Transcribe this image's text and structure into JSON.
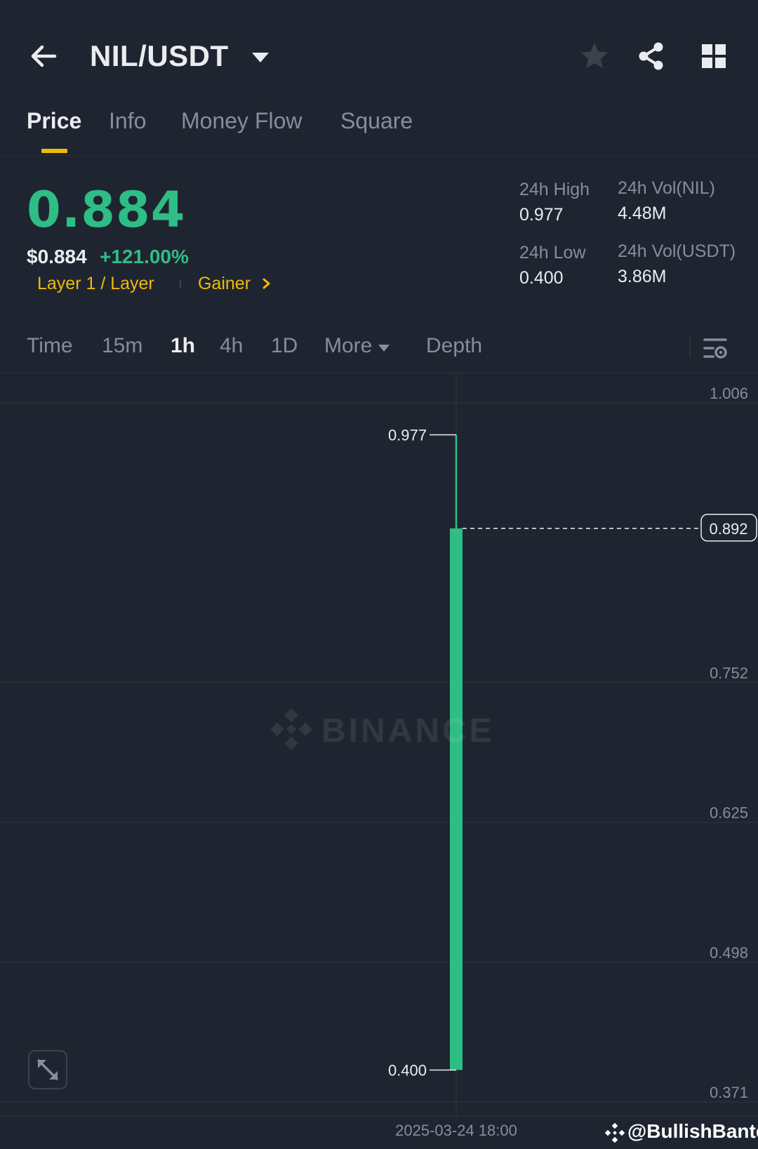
{
  "header": {
    "pair": "NIL/USDT",
    "icons": [
      "back-arrow-icon",
      "caret-down-icon",
      "star-icon",
      "share-icon",
      "grid-icon"
    ]
  },
  "tabs": [
    {
      "label": "Price",
      "active": true
    },
    {
      "label": "Info",
      "active": false
    },
    {
      "label": "Money Flow",
      "active": false
    },
    {
      "label": "Square",
      "active": false
    }
  ],
  "ticker": {
    "last_price": "0.884",
    "usd_price": "$0.884",
    "change_pct": "+121.00%",
    "tags": [
      "Layer 1 / Layer",
      "Gainer"
    ],
    "stats": {
      "high_label": "24h High",
      "high_value": "0.977",
      "low_label": "24h Low",
      "low_value": "0.400",
      "vol_base_label": "24h Vol(NIL)",
      "vol_base_value": "4.48M",
      "vol_quote_label": "24h Vol(USDT)",
      "vol_quote_value": "3.86M"
    }
  },
  "intervals": {
    "items": [
      "Time",
      "15m",
      "1h",
      "4h",
      "1D",
      "More",
      "Depth"
    ],
    "active": "1h"
  },
  "chart_data": {
    "type": "candlestick",
    "y_ticks": [
      "1.006",
      "0.752",
      "0.625",
      "0.498",
      "0.371"
    ],
    "ylim": [
      0.371,
      1.006
    ],
    "candles": [
      {
        "time": "2025-03-24 18:00",
        "open": 0.4,
        "high": 0.977,
        "low": 0.4,
        "close": 0.892
      }
    ],
    "high_label": "0.977",
    "low_label": "0.400",
    "current_price_label": "0.892",
    "x_label": "2025-03-24 18:00",
    "watermark": "BINANCE",
    "colors": {
      "up": "#2ebd85",
      "grid": "#2b313b",
      "axis_text": "#848e9c"
    }
  },
  "footer": {
    "handle": "@BullishBanter"
  }
}
